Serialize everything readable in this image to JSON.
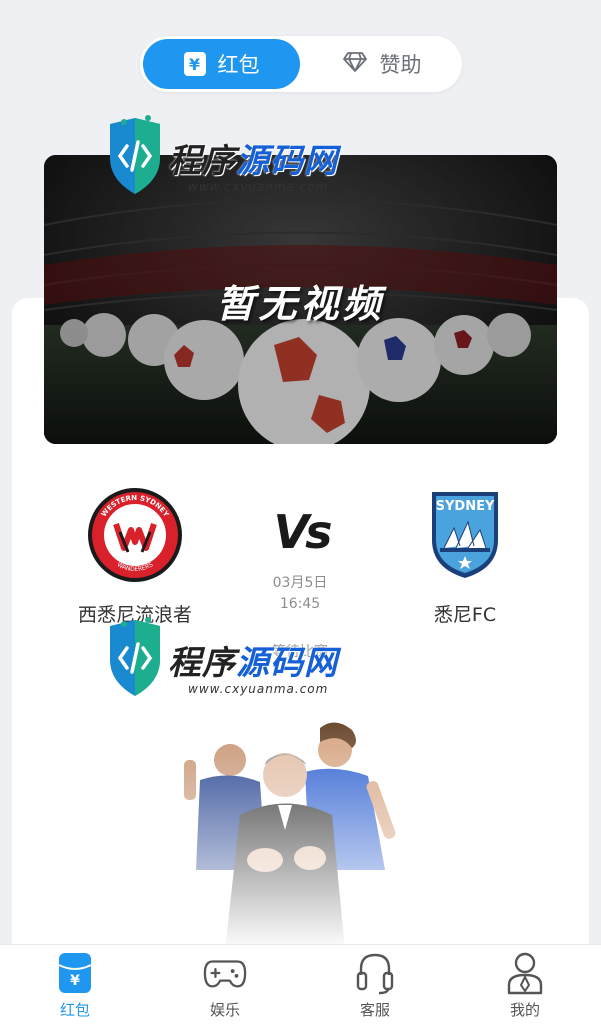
{
  "toggle": {
    "tabs": [
      {
        "label": "红包",
        "icon": "yen-box-icon",
        "active": true
      },
      {
        "label": "赞助",
        "icon": "diamond-icon",
        "active": false
      }
    ]
  },
  "video": {
    "placeholder_text": "暂无视频"
  },
  "match": {
    "home": {
      "name": "西悉尼流浪者",
      "logo_text_top": "WESTERN SYDNEY",
      "logo_text_bottom": "WANDERERS"
    },
    "away": {
      "name": "悉尼FC",
      "logo_text": "SYDNEY"
    },
    "vs": "Vs",
    "date": "03月5日",
    "time": "16:45",
    "status": "等待比赛"
  },
  "watermark": {
    "title_a": "程序",
    "title_b": "源码网",
    "url": "www.cxyuanma.com"
  },
  "nav": {
    "items": [
      {
        "label": "红包",
        "icon": "red-packet-icon",
        "active": true
      },
      {
        "label": "娱乐",
        "icon": "gamepad-icon",
        "active": false
      },
      {
        "label": "客服",
        "icon": "headset-icon",
        "active": false
      },
      {
        "label": "我的",
        "icon": "profile-icon",
        "active": false
      }
    ]
  },
  "colors": {
    "accent": "#1f97f0",
    "background": "#eef0f4",
    "home_red": "#d8212b",
    "away_blue": "#4aa3dc"
  }
}
